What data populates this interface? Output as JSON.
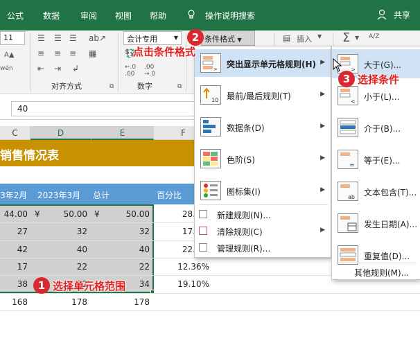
{
  "tabs": [
    "公式",
    "数据",
    "审阅",
    "视图",
    "帮助"
  ],
  "tell_me": "操作说明搜索",
  "share": "共享",
  "ribbon": {
    "font_size": "11",
    "wen": "wén",
    "number_format": "会计专用",
    "cond_format": "条件格式",
    "insert": "插入",
    "sum_symbol": "Σ",
    "sort_symbol": "A/Z",
    "groups": {
      "align": "对齐方式",
      "number": "数字"
    },
    "num_dec_inc": "←.0 .00",
    "num_dec_dec": ".00 →.0"
  },
  "formula_value": "40",
  "columns": [
    "C",
    "D",
    "E",
    "F"
  ],
  "sheet": {
    "title": "销售情况表",
    "headers": [
      "3年2月",
      "2023年3月",
      "总计",
      "百分比"
    ],
    "rows": [
      {
        "c": "44.00",
        "d_cur": "¥",
        "d": "50.00",
        "e_cur": "¥",
        "e": "50.00",
        "f": "28."
      },
      {
        "c": "27",
        "d": "32",
        "e": "32",
        "f": "17."
      },
      {
        "c": "42",
        "d": "40",
        "e": "40",
        "f": "22."
      },
      {
        "c": "17",
        "d": "22",
        "e": "22",
        "f": "12.36%"
      },
      {
        "c": "38",
        "d": "32",
        "e": "34",
        "f": "19.10%"
      },
      {
        "c": "168",
        "d": "178",
        "e": "178",
        "f": ""
      }
    ]
  },
  "menu1": {
    "items": [
      {
        "label": "突出显示单元格规则(H)",
        "icon": "highlight-rules-icon"
      },
      {
        "label": "最前/最后规则(T)",
        "icon": "top-bottom-rules-icon"
      },
      {
        "label": "数据条(D)",
        "icon": "data-bars-icon"
      },
      {
        "label": "色阶(S)",
        "icon": "color-scales-icon"
      },
      {
        "label": "图标集(I)",
        "icon": "icon-sets-icon"
      }
    ],
    "small_items": [
      {
        "label": "新建规则(N)...",
        "icon": "new-rule-icon"
      },
      {
        "label": "清除规则(C)",
        "icon": "clear-rules-icon"
      },
      {
        "label": "管理规则(R)...",
        "icon": "manage-rules-icon"
      }
    ]
  },
  "menu2": {
    "items": [
      {
        "label": "大于(G)...",
        "icon": "greater-than-icon"
      },
      {
        "label": "小于(L)...",
        "icon": "less-than-icon"
      },
      {
        "label": "介于(B)...",
        "icon": "between-icon"
      },
      {
        "label": "等于(E)...",
        "icon": "equal-to-icon"
      },
      {
        "label": "文本包含(T)...",
        "icon": "text-contains-icon"
      },
      {
        "label": "发生日期(A)...",
        "icon": "date-occurring-icon"
      },
      {
        "label": "重复值(D)...",
        "icon": "duplicate-values-icon"
      }
    ],
    "more": "其他规则(M)..."
  },
  "annotations": {
    "step1": {
      "num": "1",
      "text": "选择单元格范围"
    },
    "step2": {
      "num": "2",
      "text": "点击条件格式"
    },
    "step3": {
      "num": "3",
      "text": "选择条件"
    }
  },
  "colors": {
    "excel_green": "#217346",
    "title_bar": "#c79100",
    "header_blue": "#5b9bd5",
    "annotation_red": "#d9282f",
    "menu_highlight": "#cfe3f5"
  }
}
